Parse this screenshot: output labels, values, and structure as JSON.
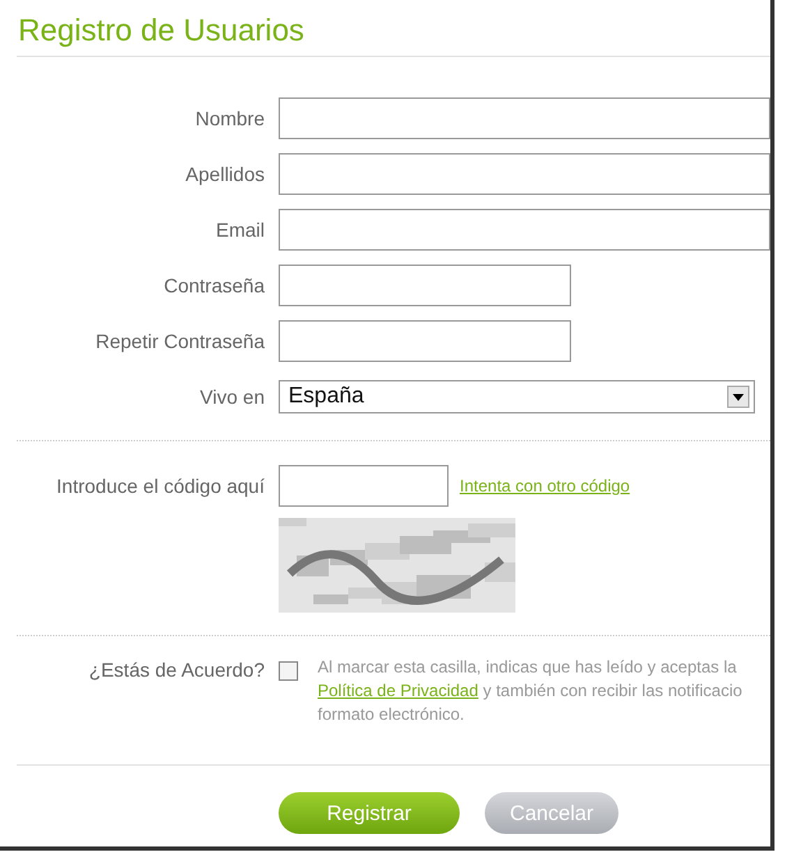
{
  "title": "Registro de Usuarios",
  "fields": [
    {
      "label": "Nombre",
      "kind": "wide"
    },
    {
      "label": "Apellidos",
      "kind": "wide"
    },
    {
      "label": "Email",
      "kind": "wide"
    },
    {
      "label": "Contraseña",
      "kind": "short"
    },
    {
      "label": "Repetir Contraseña",
      "kind": "short"
    },
    {
      "label": "Vivo en",
      "kind": "select",
      "value": "España"
    }
  ],
  "captcha": {
    "label": "Introduce el código aquí",
    "link": "Intenta con otro código"
  },
  "agreement": {
    "label": "¿Estás de Acuerdo?",
    "checked": false,
    "text_1": "Al marcar esta casilla, indicas que has leído y aceptas la",
    "link": "Política de Privacidad",
    "text_2": " y también con recibir las notificacio",
    "text_3": "formato electrónico."
  },
  "buttons": [
    {
      "label": "Registrar",
      "kind": "primary"
    },
    {
      "label": "Cancelar",
      "kind": "secondary"
    }
  ]
}
